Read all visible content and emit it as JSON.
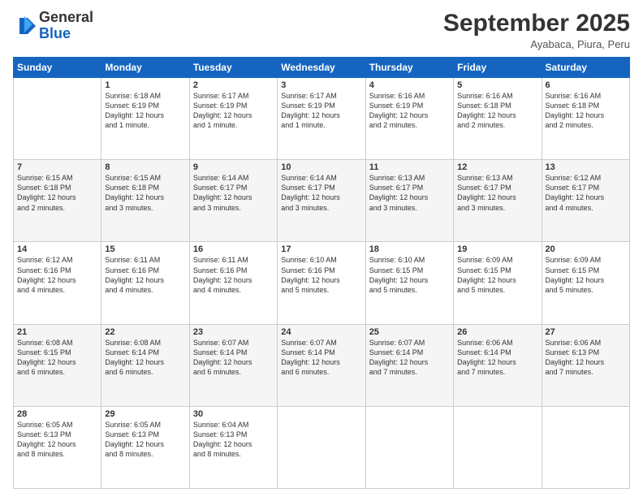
{
  "logo": {
    "general": "General",
    "blue": "Blue"
  },
  "header": {
    "month": "September 2025",
    "location": "Ayabaca, Piura, Peru"
  },
  "days_of_week": [
    "Sunday",
    "Monday",
    "Tuesday",
    "Wednesday",
    "Thursday",
    "Friday",
    "Saturday"
  ],
  "weeks": [
    [
      {
        "day": "",
        "info": ""
      },
      {
        "day": "1",
        "info": "Sunrise: 6:18 AM\nSunset: 6:19 PM\nDaylight: 12 hours\nand 1 minute."
      },
      {
        "day": "2",
        "info": "Sunrise: 6:17 AM\nSunset: 6:19 PM\nDaylight: 12 hours\nand 1 minute."
      },
      {
        "day": "3",
        "info": "Sunrise: 6:17 AM\nSunset: 6:19 PM\nDaylight: 12 hours\nand 1 minute."
      },
      {
        "day": "4",
        "info": "Sunrise: 6:16 AM\nSunset: 6:19 PM\nDaylight: 12 hours\nand 2 minutes."
      },
      {
        "day": "5",
        "info": "Sunrise: 6:16 AM\nSunset: 6:18 PM\nDaylight: 12 hours\nand 2 minutes."
      },
      {
        "day": "6",
        "info": "Sunrise: 6:16 AM\nSunset: 6:18 PM\nDaylight: 12 hours\nand 2 minutes."
      }
    ],
    [
      {
        "day": "7",
        "info": "Sunrise: 6:15 AM\nSunset: 6:18 PM\nDaylight: 12 hours\nand 2 minutes."
      },
      {
        "day": "8",
        "info": "Sunrise: 6:15 AM\nSunset: 6:18 PM\nDaylight: 12 hours\nand 3 minutes."
      },
      {
        "day": "9",
        "info": "Sunrise: 6:14 AM\nSunset: 6:17 PM\nDaylight: 12 hours\nand 3 minutes."
      },
      {
        "day": "10",
        "info": "Sunrise: 6:14 AM\nSunset: 6:17 PM\nDaylight: 12 hours\nand 3 minutes."
      },
      {
        "day": "11",
        "info": "Sunrise: 6:13 AM\nSunset: 6:17 PM\nDaylight: 12 hours\nand 3 minutes."
      },
      {
        "day": "12",
        "info": "Sunrise: 6:13 AM\nSunset: 6:17 PM\nDaylight: 12 hours\nand 3 minutes."
      },
      {
        "day": "13",
        "info": "Sunrise: 6:12 AM\nSunset: 6:17 PM\nDaylight: 12 hours\nand 4 minutes."
      }
    ],
    [
      {
        "day": "14",
        "info": "Sunrise: 6:12 AM\nSunset: 6:16 PM\nDaylight: 12 hours\nand 4 minutes."
      },
      {
        "day": "15",
        "info": "Sunrise: 6:11 AM\nSunset: 6:16 PM\nDaylight: 12 hours\nand 4 minutes."
      },
      {
        "day": "16",
        "info": "Sunrise: 6:11 AM\nSunset: 6:16 PM\nDaylight: 12 hours\nand 4 minutes."
      },
      {
        "day": "17",
        "info": "Sunrise: 6:10 AM\nSunset: 6:16 PM\nDaylight: 12 hours\nand 5 minutes."
      },
      {
        "day": "18",
        "info": "Sunrise: 6:10 AM\nSunset: 6:15 PM\nDaylight: 12 hours\nand 5 minutes."
      },
      {
        "day": "19",
        "info": "Sunrise: 6:09 AM\nSunset: 6:15 PM\nDaylight: 12 hours\nand 5 minutes."
      },
      {
        "day": "20",
        "info": "Sunrise: 6:09 AM\nSunset: 6:15 PM\nDaylight: 12 hours\nand 5 minutes."
      }
    ],
    [
      {
        "day": "21",
        "info": "Sunrise: 6:08 AM\nSunset: 6:15 PM\nDaylight: 12 hours\nand 6 minutes."
      },
      {
        "day": "22",
        "info": "Sunrise: 6:08 AM\nSunset: 6:14 PM\nDaylight: 12 hours\nand 6 minutes."
      },
      {
        "day": "23",
        "info": "Sunrise: 6:07 AM\nSunset: 6:14 PM\nDaylight: 12 hours\nand 6 minutes."
      },
      {
        "day": "24",
        "info": "Sunrise: 6:07 AM\nSunset: 6:14 PM\nDaylight: 12 hours\nand 6 minutes."
      },
      {
        "day": "25",
        "info": "Sunrise: 6:07 AM\nSunset: 6:14 PM\nDaylight: 12 hours\nand 7 minutes."
      },
      {
        "day": "26",
        "info": "Sunrise: 6:06 AM\nSunset: 6:14 PM\nDaylight: 12 hours\nand 7 minutes."
      },
      {
        "day": "27",
        "info": "Sunrise: 6:06 AM\nSunset: 6:13 PM\nDaylight: 12 hours\nand 7 minutes."
      }
    ],
    [
      {
        "day": "28",
        "info": "Sunrise: 6:05 AM\nSunset: 6:13 PM\nDaylight: 12 hours\nand 8 minutes."
      },
      {
        "day": "29",
        "info": "Sunrise: 6:05 AM\nSunset: 6:13 PM\nDaylight: 12 hours\nand 8 minutes."
      },
      {
        "day": "30",
        "info": "Sunrise: 6:04 AM\nSunset: 6:13 PM\nDaylight: 12 hours\nand 8 minutes."
      },
      {
        "day": "",
        "info": ""
      },
      {
        "day": "",
        "info": ""
      },
      {
        "day": "",
        "info": ""
      },
      {
        "day": "",
        "info": ""
      }
    ]
  ]
}
